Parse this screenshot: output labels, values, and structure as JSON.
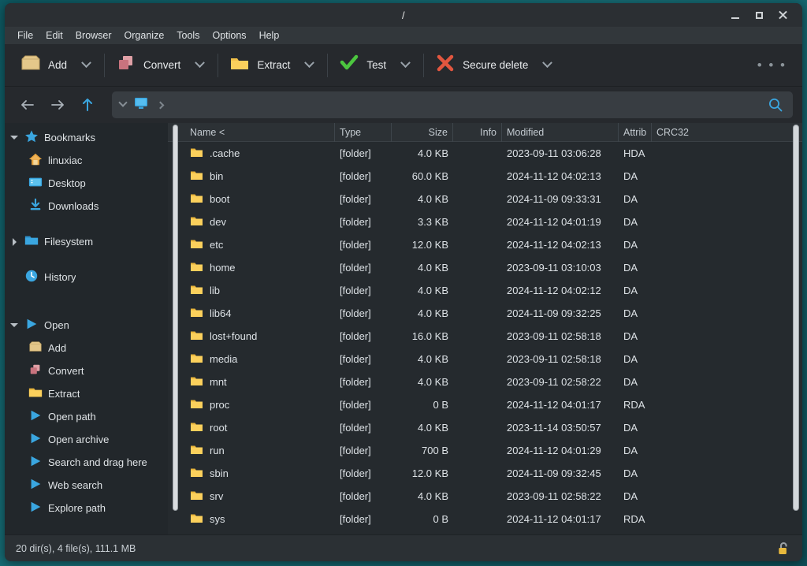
{
  "window": {
    "title": "/",
    "controls": {
      "minimize": "minimize-window",
      "maximize": "maximize-window",
      "close": "close-window"
    }
  },
  "menubar": {
    "items": [
      {
        "label": "File"
      },
      {
        "label": "Edit"
      },
      {
        "label": "Browser"
      },
      {
        "label": "Organize"
      },
      {
        "label": "Tools"
      },
      {
        "label": "Options"
      },
      {
        "label": "Help"
      }
    ]
  },
  "toolbar": {
    "buttons": [
      {
        "label": "Add",
        "icon": "archive-box-icon",
        "has_dropdown": true
      },
      {
        "label": "Convert",
        "icon": "convert-squares-icon",
        "has_dropdown": true
      },
      {
        "label": "Extract",
        "icon": "folder-icon",
        "has_dropdown": true
      },
      {
        "label": "Test",
        "icon": "green-check-icon",
        "has_dropdown": true
      },
      {
        "label": "Secure delete",
        "icon": "red-x-icon",
        "has_dropdown": true
      }
    ],
    "overflow": "• • •"
  },
  "addressbar": {
    "back": "back-arrow-icon",
    "forward": "forward-arrow-icon",
    "up": "up-arrow-icon",
    "path_value": "",
    "path_icon": "computer-monitor-icon",
    "search_icon": "search-icon"
  },
  "sidebar": {
    "sections": [
      {
        "label": "Bookmarks",
        "icon": "star-icon",
        "expanded": true,
        "children": [
          {
            "label": "linuxiac",
            "icon": "home-icon"
          },
          {
            "label": "Desktop",
            "icon": "desktop-icon"
          },
          {
            "label": "Downloads",
            "icon": "download-icon"
          }
        ]
      },
      {
        "label": "Filesystem",
        "icon": "folder-icon",
        "expanded": false,
        "children": []
      },
      {
        "label": "History",
        "icon": "history-clock-icon",
        "expanded": null,
        "children": []
      },
      {
        "label": "Open",
        "icon": "play-icon",
        "expanded": true,
        "children": [
          {
            "label": "Add",
            "icon": "archive-box-icon"
          },
          {
            "label": "Convert",
            "icon": "convert-squares-icon"
          },
          {
            "label": "Extract",
            "icon": "folder-icon"
          },
          {
            "label": "Open path",
            "icon": "play-icon"
          },
          {
            "label": "Open archive",
            "icon": "play-icon"
          },
          {
            "label": "Search and drag here",
            "icon": "play-icon"
          },
          {
            "label": "Web search",
            "icon": "play-icon"
          },
          {
            "label": "Explore path",
            "icon": "play-icon"
          }
        ]
      }
    ]
  },
  "filelist": {
    "columns": [
      {
        "key": "name",
        "label": "Name <"
      },
      {
        "key": "type",
        "label": "Type"
      },
      {
        "key": "size",
        "label": "Size"
      },
      {
        "key": "info",
        "label": "Info"
      },
      {
        "key": "modified",
        "label": "Modified"
      },
      {
        "key": "attributes",
        "label": "Attrib"
      },
      {
        "key": "crc32",
        "label": "CRC32"
      }
    ],
    "rows": [
      {
        "name": ".cache",
        "type": "[folder]",
        "size": "4.0 KB",
        "info": "",
        "modified": "2023-09-11 03:06:28",
        "attributes": "HDA",
        "crc32": ""
      },
      {
        "name": "bin",
        "type": "[folder]",
        "size": "60.0 KB",
        "info": "",
        "modified": "2024-11-12 04:02:13",
        "attributes": "DA",
        "crc32": ""
      },
      {
        "name": "boot",
        "type": "[folder]",
        "size": "4.0 KB",
        "info": "",
        "modified": "2024-11-09 09:33:31",
        "attributes": "DA",
        "crc32": ""
      },
      {
        "name": "dev",
        "type": "[folder]",
        "size": "3.3 KB",
        "info": "",
        "modified": "2024-11-12 04:01:19",
        "attributes": "DA",
        "crc32": ""
      },
      {
        "name": "etc",
        "type": "[folder]",
        "size": "12.0 KB",
        "info": "",
        "modified": "2024-11-12 04:02:13",
        "attributes": "DA",
        "crc32": ""
      },
      {
        "name": "home",
        "type": "[folder]",
        "size": "4.0 KB",
        "info": "",
        "modified": "2023-09-11 03:10:03",
        "attributes": "DA",
        "crc32": ""
      },
      {
        "name": "lib",
        "type": "[folder]",
        "size": "4.0 KB",
        "info": "",
        "modified": "2024-11-12 04:02:12",
        "attributes": "DA",
        "crc32": ""
      },
      {
        "name": "lib64",
        "type": "[folder]",
        "size": "4.0 KB",
        "info": "",
        "modified": "2024-11-09 09:32:25",
        "attributes": "DA",
        "crc32": ""
      },
      {
        "name": "lost+found",
        "type": "[folder]",
        "size": "16.0 KB",
        "info": "",
        "modified": "2023-09-11 02:58:18",
        "attributes": "DA",
        "crc32": ""
      },
      {
        "name": "media",
        "type": "[folder]",
        "size": "4.0 KB",
        "info": "",
        "modified": "2023-09-11 02:58:18",
        "attributes": "DA",
        "crc32": ""
      },
      {
        "name": "mnt",
        "type": "[folder]",
        "size": "4.0 KB",
        "info": "",
        "modified": "2023-09-11 02:58:22",
        "attributes": "DA",
        "crc32": ""
      },
      {
        "name": "proc",
        "type": "[folder]",
        "size": "0 B",
        "info": "",
        "modified": "2024-11-12 04:01:17",
        "attributes": "RDA",
        "crc32": ""
      },
      {
        "name": "root",
        "type": "[folder]",
        "size": "4.0 KB",
        "info": "",
        "modified": "2023-11-14 03:50:57",
        "attributes": "DA",
        "crc32": ""
      },
      {
        "name": "run",
        "type": "[folder]",
        "size": "700 B",
        "info": "",
        "modified": "2024-11-12 04:01:29",
        "attributes": "DA",
        "crc32": ""
      },
      {
        "name": "sbin",
        "type": "[folder]",
        "size": "12.0 KB",
        "info": "",
        "modified": "2024-11-09 09:32:45",
        "attributes": "DA",
        "crc32": ""
      },
      {
        "name": "srv",
        "type": "[folder]",
        "size": "4.0 KB",
        "info": "",
        "modified": "2023-09-11 02:58:22",
        "attributes": "DA",
        "crc32": ""
      },
      {
        "name": "sys",
        "type": "[folder]",
        "size": "0 B",
        "info": "",
        "modified": "2024-11-12 04:01:17",
        "attributes": "RDA",
        "crc32": ""
      }
    ]
  },
  "statusbar": {
    "summary": "20 dir(s), 4 file(s), 111.1 MB",
    "lock_icon": "unlocked-padlock-icon"
  },
  "colors": {
    "desktop": "#15666e",
    "window_bg": "#252a2e",
    "titlebar": "#2b2f33",
    "menubar": "#32373b",
    "accent_blue": "#3aa6e0",
    "folder_yellow": "#f2c14a",
    "check_green": "#4cc63f",
    "x_red": "#e2563f",
    "convert_pink": "#d08189"
  }
}
